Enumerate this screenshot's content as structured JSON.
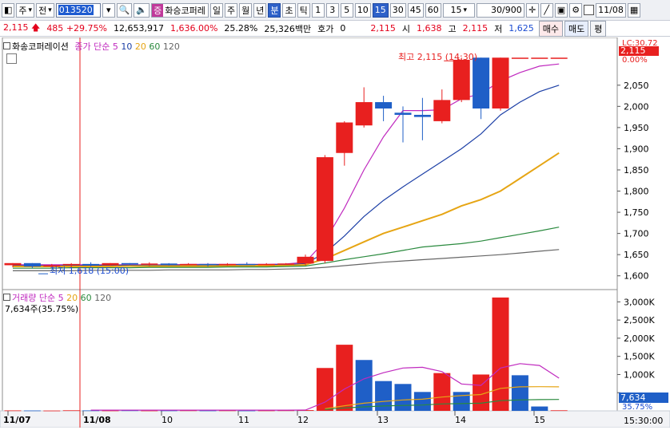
{
  "toolbar": {
    "market": "주",
    "type": "전",
    "code": "013520",
    "name_prefix": "증",
    "name": "화승코퍼레",
    "periods": [
      "일",
      "주",
      "월",
      "년",
      "분",
      "초",
      "틱"
    ],
    "minutes": [
      "1",
      "3",
      "5",
      "10",
      "15",
      "30",
      "45",
      "60"
    ],
    "minute_input": "15",
    "count": "30/900",
    "date": "11/08"
  },
  "quote": {
    "price": "2,115",
    "change": "485",
    "change_pct": "+29.75%",
    "volume": "12,653,917",
    "vol_ratio": "1,636.00%",
    "turnover": "25.28%",
    "amount": "25,326백만",
    "hoga_label": "호가",
    "hoga_value": "0",
    "price2": "2,115",
    "open_label": "시",
    "open": "1,638",
    "high_label": "고",
    "high": "2,115",
    "low_label": "저",
    "low": "1,625",
    "buy": "매수",
    "sell": "매도",
    "pyeong": "평"
  },
  "legend_price": {
    "title": "화송코퍼레이션",
    "ma_label": "종가 단순 5",
    "ma2": "10",
    "ma3": "20",
    "ma4": "60",
    "ma5": "120"
  },
  "legend_vol": {
    "title": "거래량 단순 5",
    "ma2": "20",
    "ma3": "60",
    "ma4": "120",
    "current": "7,634주(35.75%)"
  },
  "annotations": {
    "high": "최고 2,115 (14:30)",
    "low": "최저 1,618 (15:00)",
    "price_tag": "2,115",
    "pct_top": "0.00%",
    "lc": "LC:30.72",
    "vol_tag": "7,634",
    "vol_pct": "35.75%",
    "time": "15:30:00"
  },
  "colors": {
    "up": "#e8201f",
    "down": "#1f5fc7",
    "ma5": "#c02abf",
    "ma10": "#1c3fa6",
    "ma20": "#e6a514",
    "ma60": "#2a8a3e",
    "ma120": "#666666"
  },
  "chart_data": [
    {
      "type": "candlestick",
      "title": "화송코퍼레이션",
      "ylim": [
        1575,
        2140
      ],
      "yticks": [
        1600,
        1650,
        1700,
        1750,
        1800,
        1850,
        1900,
        1950,
        2000,
        2050
      ],
      "candles": [
        {
          "o": 1625,
          "h": 1630,
          "l": 1620,
          "c": 1630
        },
        {
          "o": 1630,
          "h": 1630,
          "l": 1618,
          "c": 1622
        },
        {
          "o": 1622,
          "h": 1628,
          "l": 1620,
          "c": 1625
        },
        {
          "o": 1625,
          "h": 1630,
          "l": 1620,
          "c": 1628
        },
        {
          "o": 1628,
          "h": 1632,
          "l": 1622,
          "c": 1625
        },
        {
          "o": 1625,
          "h": 1630,
          "l": 1624,
          "c": 1630
        },
        {
          "o": 1630,
          "h": 1630,
          "l": 1625,
          "c": 1627
        },
        {
          "o": 1627,
          "h": 1632,
          "l": 1623,
          "c": 1629
        },
        {
          "o": 1629,
          "h": 1630,
          "l": 1624,
          "c": 1626
        },
        {
          "o": 1626,
          "h": 1630,
          "l": 1625,
          "c": 1628
        },
        {
          "o": 1628,
          "h": 1630,
          "l": 1622,
          "c": 1626
        },
        {
          "o": 1626,
          "h": 1630,
          "l": 1624,
          "c": 1628
        },
        {
          "o": 1628,
          "h": 1632,
          "l": 1625,
          "c": 1627
        },
        {
          "o": 1627,
          "h": 1630,
          "l": 1625,
          "c": 1628
        },
        {
          "o": 1628,
          "h": 1630,
          "l": 1626,
          "c": 1629
        },
        {
          "o": 1629,
          "h": 1650,
          "l": 1625,
          "c": 1645
        },
        {
          "o": 1635,
          "h": 1885,
          "l": 1630,
          "c": 1880
        },
        {
          "o": 1890,
          "h": 1965,
          "l": 1860,
          "c": 1962
        },
        {
          "o": 1955,
          "h": 2045,
          "l": 1950,
          "c": 2010
        },
        {
          "o": 2010,
          "h": 2025,
          "l": 1965,
          "c": 1995
        },
        {
          "o": 1985,
          "h": 2000,
          "l": 1915,
          "c": 1980
        },
        {
          "o": 1980,
          "h": 2020,
          "l": 1920,
          "c": 1975
        },
        {
          "o": 1965,
          "h": 2040,
          "l": 1960,
          "c": 2015
        },
        {
          "o": 2015,
          "h": 2115,
          "l": 2010,
          "c": 2110
        },
        {
          "o": 2115,
          "h": 2115,
          "l": 1970,
          "c": 1995
        },
        {
          "o": 1995,
          "h": 2115,
          "l": 1990,
          "c": 2115
        },
        {
          "o": 2115,
          "h": 2115,
          "l": 2115,
          "c": 2115
        },
        {
          "o": 2115,
          "h": 2115,
          "l": 2115,
          "c": 2115
        },
        {
          "o": 2115,
          "h": 2115,
          "l": 2115,
          "c": 2115
        }
      ],
      "series": [
        {
          "name": "5",
          "values": [
            1626,
            1626,
            1626,
            1626,
            1626,
            1626,
            1626,
            1626,
            1626,
            1627,
            1627,
            1627,
            1627,
            1627,
            1628,
            1632,
            1682,
            1760,
            1850,
            1928,
            1990,
            1990,
            1992,
            2018,
            2030,
            2060,
            2080,
            2095,
            2100
          ]
        },
        {
          "name": "10",
          "values": [
            1624,
            1624,
            1624,
            1624,
            1624,
            1625,
            1625,
            1625,
            1625,
            1625,
            1626,
            1626,
            1626,
            1626,
            1626,
            1629,
            1654,
            1694,
            1740,
            1778,
            1810,
            1840,
            1870,
            1900,
            1935,
            1980,
            2010,
            2035,
            2050
          ]
        },
        {
          "name": "20",
          "values": [
            1622,
            1622,
            1622,
            1622,
            1622,
            1622,
            1623,
            1623,
            1623,
            1623,
            1623,
            1623,
            1624,
            1624,
            1624,
            1626,
            1640,
            1660,
            1680,
            1700,
            1715,
            1730,
            1745,
            1765,
            1780,
            1800,
            1830,
            1860,
            1890
          ]
        },
        {
          "name": "60",
          "values": [
            1618,
            1618,
            1618,
            1619,
            1619,
            1619,
            1619,
            1620,
            1620,
            1620,
            1620,
            1621,
            1621,
            1621,
            1622,
            1623,
            1630,
            1638,
            1645,
            1652,
            1660,
            1668,
            1672,
            1676,
            1682,
            1690,
            1698,
            1706,
            1715
          ]
        },
        {
          "name": "120",
          "values": [
            1612,
            1612,
            1612,
            1612,
            1613,
            1613,
            1613,
            1613,
            1614,
            1614,
            1614,
            1614,
            1615,
            1615,
            1616,
            1617,
            1620,
            1624,
            1628,
            1632,
            1635,
            1638,
            1641,
            1644,
            1647,
            1650,
            1654,
            1658,
            1662
          ]
        }
      ]
    },
    {
      "type": "bar",
      "title": "거래량",
      "ylim": [
        0,
        3250
      ],
      "yticks": [
        500,
        1000,
        1500,
        2000,
        2500,
        3000
      ],
      "ytick_labels": [
        "",
        "1,000K",
        "1,500K",
        "2,000K",
        "2,500K",
        "3,000K"
      ],
      "values": [
        12,
        10,
        8,
        15,
        12,
        10,
        14,
        9,
        11,
        13,
        10,
        12,
        9,
        11,
        14,
        20,
        1180,
        1820,
        1400,
        820,
        740,
        520,
        1040,
        520,
        1000,
        3120,
        980,
        120,
        15
      ],
      "up": [
        1,
        0,
        1,
        1,
        0,
        1,
        0,
        1,
        0,
        1,
        0,
        1,
        0,
        1,
        1,
        1,
        1,
        1,
        0,
        0,
        0,
        0,
        1,
        0,
        1,
        1,
        0,
        0,
        1
      ],
      "ma": [
        {
          "name": "5",
          "values": [
            null,
            null,
            null,
            null,
            20,
            20,
            20,
            20,
            20,
            20,
            20,
            20,
            20,
            20,
            20,
            22,
            240,
            600,
            880,
            1050,
            1180,
            1200,
            1080,
            740,
            700,
            1180,
            1300,
            1250,
            900
          ]
        },
        {
          "name": "20",
          "values": [
            null,
            null,
            null,
            null,
            null,
            null,
            null,
            null,
            null,
            null,
            null,
            null,
            null,
            null,
            null,
            null,
            60,
            140,
            210,
            260,
            300,
            320,
            380,
            420,
            450,
            620,
            660,
            665,
            660
          ]
        },
        {
          "name": "60",
          "values": [
            null,
            null,
            null,
            null,
            null,
            null,
            null,
            null,
            null,
            null,
            null,
            null,
            null,
            null,
            null,
            null,
            40,
            80,
            110,
            135,
            150,
            160,
            190,
            200,
            210,
            280,
            300,
            310,
            315
          ]
        }
      ]
    }
  ],
  "x_labels": [
    "11/07",
    "11/08",
    "10",
    "11",
    "12",
    "13",
    "14",
    "15"
  ]
}
